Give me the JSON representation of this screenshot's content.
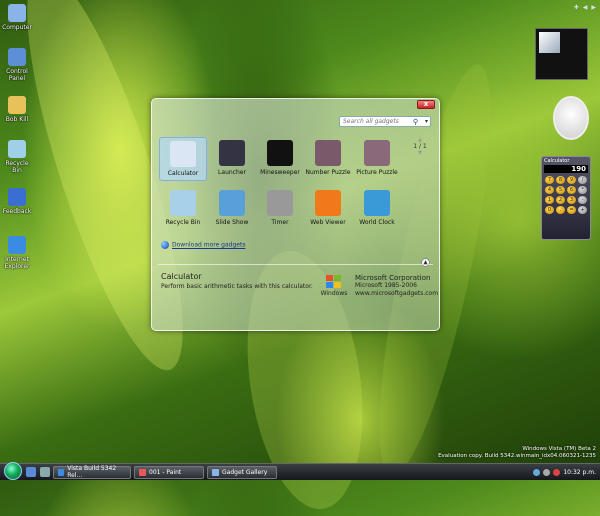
{
  "desktop_icons": [
    {
      "label": "Computer",
      "icon": "computer-icon",
      "color": "#8ab4e8"
    },
    {
      "label": "Control Panel",
      "icon": "control-panel-icon",
      "color": "#5d8fd6"
    },
    {
      "label": "Bob Kill",
      "icon": "folder-icon",
      "color": "#e8c15a"
    },
    {
      "label": "Recycle Bin",
      "icon": "recycle-bin-icon",
      "color": "#9fd0e8"
    },
    {
      "label": "Feedback",
      "icon": "feedback-icon",
      "color": "#3a6ed0"
    },
    {
      "label": "Internet Explorer",
      "icon": "internet-explorer-icon",
      "color": "#3a8ce0"
    }
  ],
  "gallery": {
    "close_label": "x",
    "search_placeholder": "Search all gadgets",
    "page_indicator": "1 / 1",
    "gadgets": [
      {
        "name": "Calculator",
        "icon": "calculator-icon",
        "color": "#dbe6f5",
        "selected": true
      },
      {
        "name": "Launcher",
        "icon": "launcher-icon",
        "color": "#334"
      },
      {
        "name": "Minesweeper",
        "icon": "minesweeper-icon",
        "color": "#111"
      },
      {
        "name": "Number Puzzle",
        "icon": "number-puzzle-icon",
        "color": "#7a5a6a"
      },
      {
        "name": "Picture Puzzle",
        "icon": "picture-puzzle-icon",
        "color": "#8a6a7a"
      },
      {
        "name": "Recycle Bin",
        "icon": "recycle-bin-icon",
        "color": "#a8d0e8"
      },
      {
        "name": "Slide Show",
        "icon": "slide-show-icon",
        "color": "#5aa0d8"
      },
      {
        "name": "Timer",
        "icon": "timer-icon",
        "color": "#999"
      },
      {
        "name": "Web Viewer",
        "icon": "rss-icon",
        "color": "#f07a1a"
      },
      {
        "name": "World Clock",
        "icon": "world-clock-icon",
        "color": "#3a9ad8"
      }
    ],
    "download_link": "Download more gadgets",
    "details": {
      "title": "Calculator",
      "description": "Perform basic arithmetic tasks with this calculator.",
      "logo_text": "Windows",
      "publisher": "Microsoft Corporation",
      "copyright": "Microsoft 1985-2006",
      "url": "www.microsoftgadgets.com"
    }
  },
  "sidebar": {
    "calculator": {
      "title": "Calculator",
      "display": "190",
      "keys": [
        "7",
        "8",
        "9",
        "/",
        "4",
        "5",
        "6",
        "*",
        "1",
        "2",
        "3",
        "-",
        "0",
        ".",
        "=",
        "+"
      ]
    }
  },
  "watermark": {
    "line1": "Windows Vista (TM) Beta 2",
    "line2": "Evaluation copy. Build 5342.winmain_idx04.060321-1235"
  },
  "taskbar": {
    "tasks": [
      {
        "label": "Vista Build 5342 Rel...",
        "icon": "browser-icon",
        "color": "#3a8ce0"
      },
      {
        "label": "001 - Paint",
        "icon": "paint-icon",
        "color": "#e85a5a"
      },
      {
        "label": "Gadget Gallery",
        "icon": "gadget-gallery-icon",
        "color": "#8ab4e8"
      }
    ],
    "clock": "10:32 p.m."
  }
}
